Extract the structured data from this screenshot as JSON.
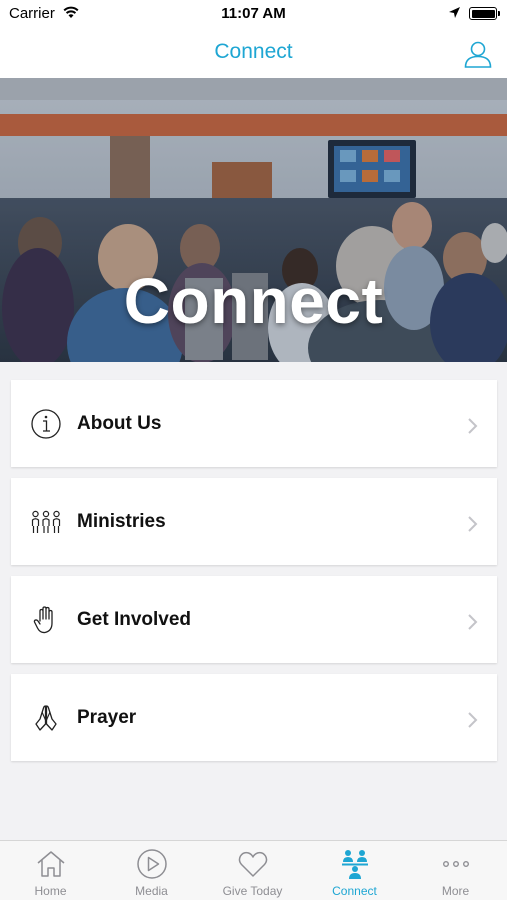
{
  "status_bar": {
    "carrier": "Carrier",
    "time": "11:07 AM"
  },
  "nav": {
    "title": "Connect",
    "profile_icon": "person-icon"
  },
  "hero": {
    "title": "Connect",
    "image": "church lobby crowd photo"
  },
  "menu": {
    "items": [
      {
        "label": "About Us",
        "icon": "info-circle-icon"
      },
      {
        "label": "Ministries",
        "icon": "people-group-icon"
      },
      {
        "label": "Get Involved",
        "icon": "raised-hand-icon"
      },
      {
        "label": "Prayer",
        "icon": "praying-hands-icon"
      }
    ]
  },
  "tabs": [
    {
      "label": "Home",
      "icon": "house-icon"
    },
    {
      "label": "Media",
      "icon": "play-circle-icon"
    },
    {
      "label": "Give Today",
      "icon": "heart-icon"
    },
    {
      "label": "Connect",
      "icon": "people-connect-icon",
      "active": true
    },
    {
      "label": "More",
      "icon": "ellipsis-icon"
    }
  ],
  "colors": {
    "accent": "#1ea6d3",
    "background": "#f2f2f4",
    "inactive": "#8e8e93"
  }
}
